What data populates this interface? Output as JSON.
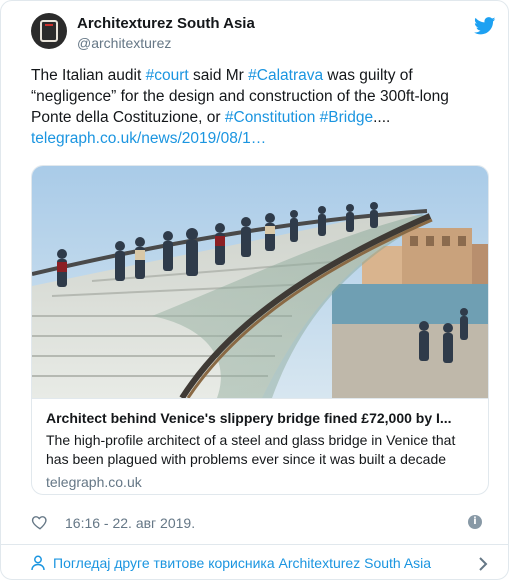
{
  "author": {
    "name": "Architexturez South Asia",
    "handle": "@architexturez"
  },
  "tweet": {
    "t1": "The Italian audit ",
    "court": "#court",
    "t2": " said Mr ",
    "calatrava": "#Calatrava",
    "t3": " was guilty of “negligence” for the design and construction of the 300ft-long Ponte della Costituzione, or ",
    "constitution": "#Constitution",
    "bridge": "#Bridge",
    "t4": "....",
    "link": "telegraph.co.uk/news/2019/08/1…"
  },
  "card": {
    "title": "Architect behind Venice's slippery bridge fined £72,000 by I...",
    "description": "The high-profile architect of a steel and glass bridge in Venice that has been plagued with problems ever since it was built a decade",
    "domain": "telegraph.co.uk"
  },
  "meta": {
    "timestamp": "16:16 - 22. авг 2019."
  },
  "footer": {
    "label": "Погледај друге твитове корисника Architexturez South Asia"
  },
  "colors": {
    "link": "#1b95e0",
    "twitter_blue": "#1da1f2",
    "muted": "#657786"
  },
  "icons": [
    "twitter-bird-icon",
    "heart-icon",
    "info-icon",
    "person-icon",
    "chevron-right-icon"
  ]
}
